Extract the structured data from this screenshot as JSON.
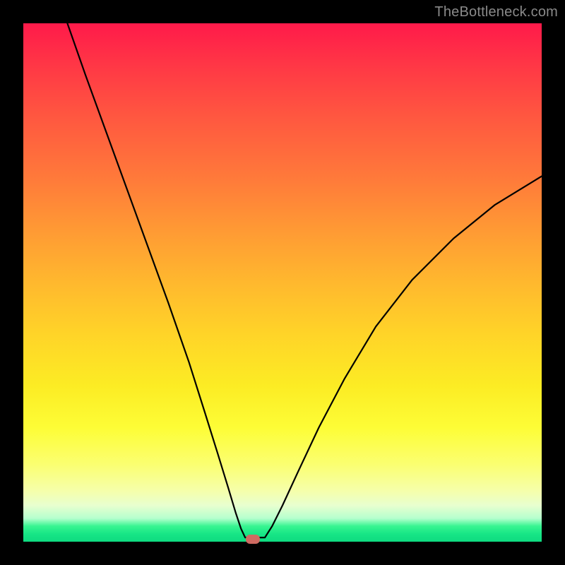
{
  "watermark": "TheBottleneck.com",
  "colors": {
    "frame": "#000000",
    "curve": "#000000",
    "marker": "#cf6a61"
  },
  "chart_data": {
    "type": "line",
    "title": "",
    "xlabel": "",
    "ylabel": "",
    "xlim": [
      0,
      100
    ],
    "ylim": [
      0,
      100
    ],
    "gradient_stops": [
      {
        "pos": 0,
        "color": "#ff1a4a"
      },
      {
        "pos": 0.3,
        "color": "#ff7a3a"
      },
      {
        "pos": 0.6,
        "color": "#ffd428"
      },
      {
        "pos": 0.78,
        "color": "#fdfd36"
      },
      {
        "pos": 0.93,
        "color": "#e8ffcf"
      },
      {
        "pos": 0.97,
        "color": "#37f591"
      },
      {
        "pos": 1.0,
        "color": "#0edb80"
      }
    ],
    "series": [
      {
        "name": "left-branch",
        "x": [
          8.5,
          12,
          16,
          20,
          24,
          28,
          32,
          35,
          37.5,
          39.5,
          41,
          42,
          42.8
        ],
        "y": [
          100,
          90,
          79,
          68,
          57,
          46,
          34.5,
          25,
          17,
          10.5,
          5.5,
          2.5,
          0.8
        ]
      },
      {
        "name": "flat-bottom",
        "x": [
          42.8,
          46.6
        ],
        "y": [
          0.8,
          0.8
        ]
      },
      {
        "name": "right-branch",
        "x": [
          46.6,
          48,
          50,
          53,
          57,
          62,
          68,
          75,
          83,
          91,
          100
        ],
        "y": [
          0.8,
          3,
          7,
          13.5,
          22,
          31.5,
          41.5,
          50.5,
          58.5,
          65,
          70.5
        ]
      }
    ],
    "marker": {
      "x": 44.3,
      "y": 0.6
    }
  }
}
